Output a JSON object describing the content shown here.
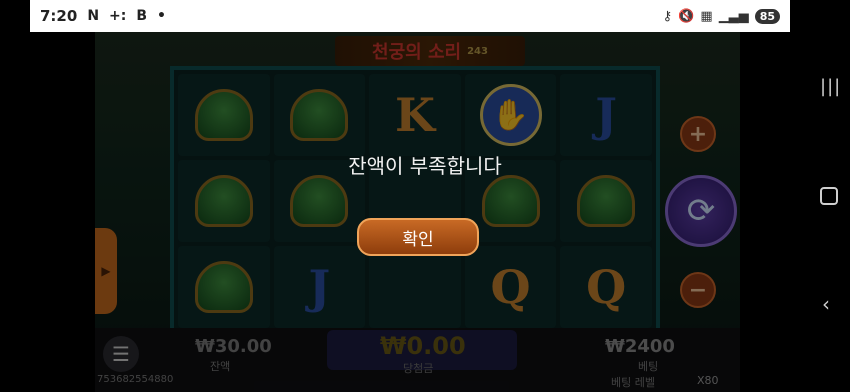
{
  "status_bar": {
    "time": "7:20",
    "left_icons": [
      "N",
      "+:",
      "B",
      "•"
    ],
    "battery": "85"
  },
  "game": {
    "title": "천궁의 소리",
    "ways": "243",
    "reels": [
      [
        "pot",
        "pot",
        "letter-k",
        "hand",
        "letter-j"
      ],
      [
        "pot",
        "pot",
        "blank",
        "pot",
        "pot"
      ],
      [
        "pot",
        "letter-j",
        "blank",
        "letter-q",
        "letter-q"
      ]
    ],
    "controls": {
      "plus": "+",
      "minus": "−",
      "spin": "⟳"
    }
  },
  "bottom_bar": {
    "credit_value": "₩30.00",
    "credit_label": "잔액",
    "win_value": "₩0.00",
    "win_label": "당첨금",
    "bet_value": "₩2400",
    "bet_label": "베팅",
    "session_id": "753682554880",
    "bet_level_label": "베팅 레벨",
    "bet_level_value": "X80"
  },
  "dialog": {
    "message": "잔액이 부족합니다",
    "confirm_label": "확인"
  },
  "colors": {
    "accent_orange": "#c86a25",
    "win_gold": "#6a5a14",
    "reel_frame": "#0f4d4f"
  }
}
